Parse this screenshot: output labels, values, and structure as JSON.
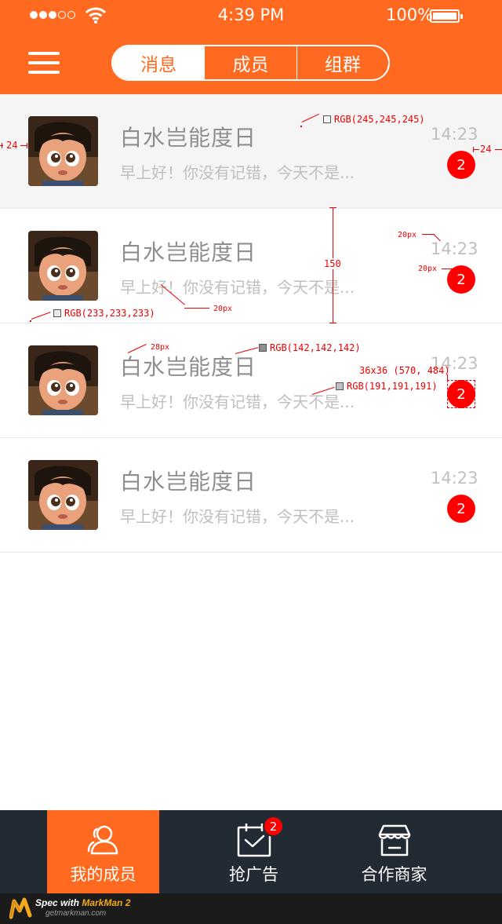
{
  "status_bar": {
    "time": "4:39 PM",
    "battery": "100%"
  },
  "header": {
    "tabs": [
      {
        "label": "消息",
        "active": true
      },
      {
        "label": "成员",
        "active": false
      },
      {
        "label": "组群",
        "active": false
      }
    ]
  },
  "messages": [
    {
      "name": "白水岂能度日",
      "preview": "早上好！你没有记错，今天不是...",
      "time": "14:23",
      "unread": "2",
      "selected": true
    },
    {
      "name": "白水岂能度日",
      "preview": "早上好！你没有记错，今天不是...",
      "time": "14:23",
      "unread": "2",
      "selected": false
    },
    {
      "name": "白水岂能度日",
      "preview": "早上好！你没有记错，今天不是...",
      "time": "14:23",
      "unread": "2",
      "selected": false
    },
    {
      "name": "白水岂能度日",
      "preview": "早上好！你没有记错，今天不是...",
      "time": "14:23",
      "unread": "2",
      "selected": false
    }
  ],
  "tabbar": {
    "items": [
      {
        "label": "我的成员",
        "icon": "members-icon",
        "active": true
      },
      {
        "label": "抢广告",
        "icon": "calendar-check-icon",
        "active": false,
        "badge": "2"
      },
      {
        "label": "合作商家",
        "icon": "store-icon",
        "active": false
      }
    ]
  },
  "spec": {
    "margin_left": "24",
    "margin_right": "24",
    "selected_bg": "RGB(245,245,245)",
    "time_gap": "20px",
    "badge_gap": "20px",
    "avatar_gap": "20px",
    "row_height": "150",
    "divider": "RGB(233,233,233)",
    "name_size": "28px",
    "name_color": "RGB(142,142,142)",
    "preview_color": "RGB(191,191,191)",
    "badge_box": "36x36 (570, 484)"
  },
  "footer": {
    "title_prefix": "Spec with ",
    "title_brand": "MarkMan 2",
    "url": "getmarkman.com"
  },
  "colors": {
    "accent": "#ff6a20",
    "badge": "#ff0000",
    "tabbar_bg": "#222b33",
    "selected_row": "#f5f5f5",
    "divider": "#e9e9e9",
    "name_text": "#8e8e8e",
    "preview_text": "#bfbfbf"
  }
}
